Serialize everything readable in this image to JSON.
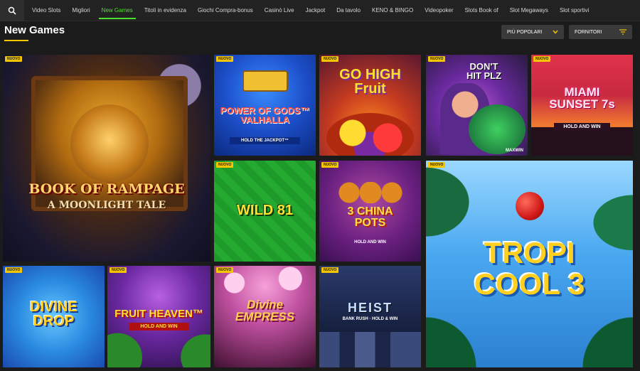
{
  "nav": {
    "items": [
      "Video Slots",
      "Migliori",
      "New Games",
      "Titoli in evidenza",
      "Giochi Compra-bonus",
      "Casinò Live",
      "Jackpot",
      "Da tavolo",
      "KENO & BINGO",
      "Videopoker",
      "Slots Book of",
      "Slot Megaways",
      "Slot sportivi"
    ],
    "active": "New Games"
  },
  "page": {
    "title": "New Games"
  },
  "filters": {
    "sort_label": "PIÙ POPOLARI",
    "providers_label": "FORNITORI"
  },
  "badge_label": "NUOVO",
  "games": [
    {
      "name": "BOOK OF RAMPAGE",
      "sub": "A MOONLIGHT TALE"
    },
    {
      "name": "POWER OF GODS™ VALHALLA",
      "sub": "HOLD THE JACKPOT™"
    },
    {
      "name": "GO HIGH Fruit",
      "sub": ""
    },
    {
      "name": "DON'T HIT PLZ",
      "sub": "MAXWIN"
    },
    {
      "name": "MIAMI SUNSET 7s",
      "sub": "HOLD AND WIN"
    },
    {
      "name": "WILD 81",
      "sub": ""
    },
    {
      "name": "3 CHINA POTS",
      "sub": "HOLD AND WIN"
    },
    {
      "name": "TROPI COOL 3",
      "sub": ""
    },
    {
      "name": "DIVINE DROP",
      "sub": ""
    },
    {
      "name": "FRUIT HEAVEN™",
      "sub": "HOLD AND WIN"
    },
    {
      "name": "Divine EMPRESS",
      "sub": ""
    },
    {
      "name": "HEIST",
      "sub": "BANK RUSH · HOLD & WIN"
    }
  ],
  "icons": {
    "search": "search-icon",
    "sort_chevron": "chevron-down-icon",
    "filter": "filter-icon"
  },
  "colors": {
    "accent_green": "#4ee02e",
    "badge_yellow": "#f2c500"
  }
}
